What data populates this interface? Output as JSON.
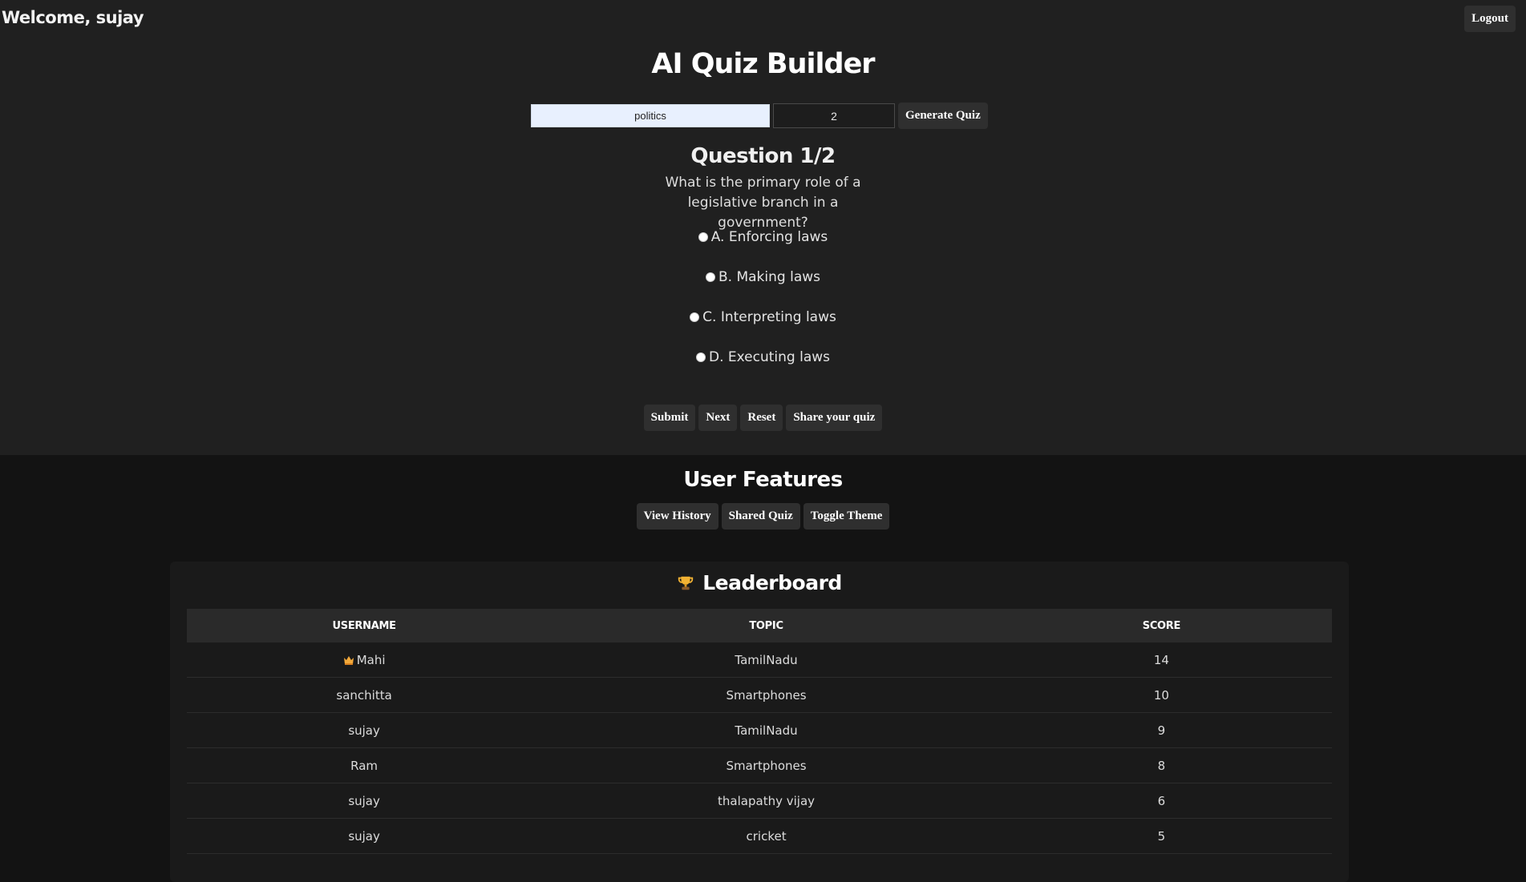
{
  "header": {
    "welcome": "Welcome, sujay",
    "logout_label": "Logout"
  },
  "app": {
    "title": "AI Quiz Builder"
  },
  "controls": {
    "topic_value": "politics",
    "count_value": "2",
    "generate_label": "Generate Quiz"
  },
  "quiz": {
    "heading": "Question 1/2",
    "question": "What is the primary role of a legislative branch in a government?",
    "options": [
      "A. Enforcing laws",
      "B. Making laws",
      "C. Interpreting laws",
      "D. Executing laws"
    ],
    "actions": {
      "submit": "Submit",
      "next": "Next",
      "reset": "Reset",
      "share": "Share your quiz"
    }
  },
  "features": {
    "title": "User Features",
    "view_history": "View History",
    "shared_quiz": "Shared Quiz",
    "toggle_theme": "Toggle Theme"
  },
  "leaderboard": {
    "title": "Leaderboard",
    "icon": "trophy-icon",
    "columns": [
      "USERNAME",
      "TOPIC",
      "SCORE"
    ],
    "rows": [
      {
        "username": "Mahi",
        "topic": "TamilNadu",
        "score": "14",
        "icon": "crown-icon"
      },
      {
        "username": "sanchitta",
        "topic": "Smartphones",
        "score": "10"
      },
      {
        "username": "sujay",
        "topic": "TamilNadu",
        "score": "9"
      },
      {
        "username": "Ram",
        "topic": "Smartphones",
        "score": "8"
      },
      {
        "username": "sujay",
        "topic": "thalapathy vijay",
        "score": "6"
      },
      {
        "username": "sujay",
        "topic": "cricket",
        "score": "5"
      }
    ]
  },
  "colors": {
    "top_background": "#202020",
    "page_background": "#131313",
    "button_background": "#2f2f2f",
    "topic_input_background": "#e8f0fe",
    "table_header_background": "#2a2a2a"
  }
}
